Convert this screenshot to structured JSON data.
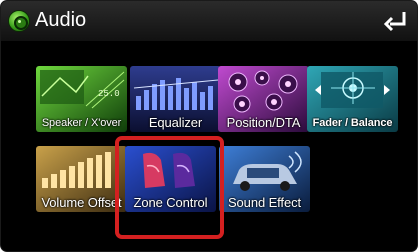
{
  "header": {
    "title": "Audio",
    "icon": "audio-disc-icon",
    "back_icon": "back-arrow-icon"
  },
  "tiles": [
    {
      "label": "Speaker / X'over"
    },
    {
      "label": "Equalizer"
    },
    {
      "label": "Position/DTA"
    },
    {
      "label": "Fader / Balance"
    },
    {
      "label": "Volume Offset"
    },
    {
      "label": "Zone Control"
    },
    {
      "label": "Sound Effect"
    }
  ],
  "colors": {
    "background": "#000000",
    "highlight": "#d42020",
    "app_icon": "#3aa11c"
  }
}
